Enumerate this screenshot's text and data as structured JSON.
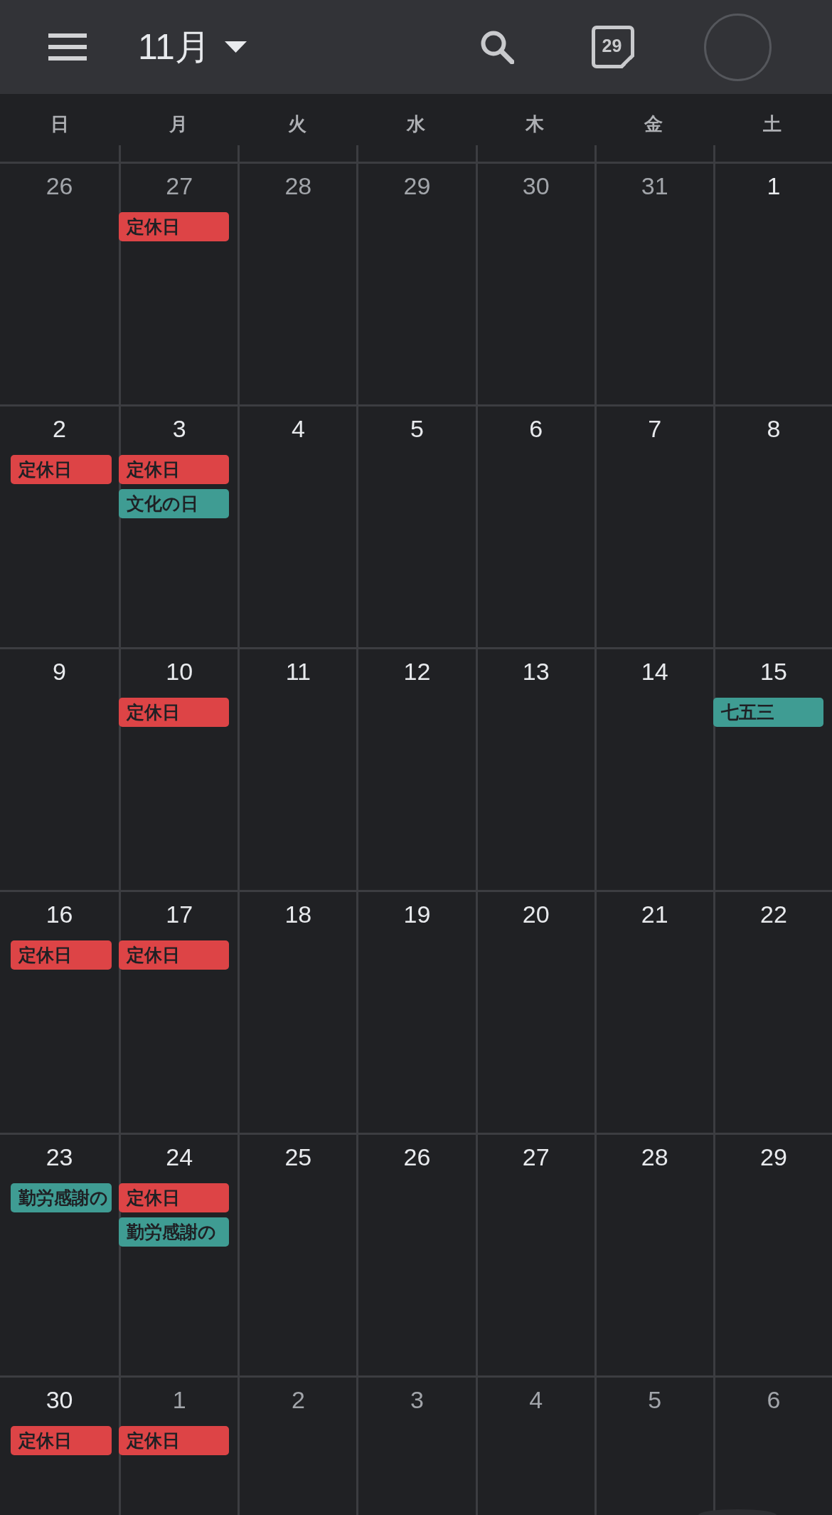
{
  "app_bar": {
    "month_title": "11月",
    "today_button": {
      "label": "29"
    }
  },
  "weekdays": [
    "日",
    "月",
    "火",
    "水",
    "木",
    "金",
    "土"
  ],
  "weeks": [
    {
      "days": [
        {
          "date": "26",
          "in_month": false
        },
        {
          "date": "27",
          "in_month": false,
          "events": [
            {
              "title": "定休日",
              "color": "#dd4446"
            }
          ]
        },
        {
          "date": "28",
          "in_month": false
        },
        {
          "date": "29",
          "in_month": false
        },
        {
          "date": "30",
          "in_month": false
        },
        {
          "date": "31",
          "in_month": false
        },
        {
          "date": "1",
          "in_month": true
        }
      ]
    },
    {
      "days": [
        {
          "date": "2",
          "in_month": true,
          "events": [
            {
              "title": "定休日",
              "color": "#dd4446"
            }
          ]
        },
        {
          "date": "3",
          "in_month": true,
          "events": [
            {
              "title": "定休日",
              "color": "#dd4446"
            },
            {
              "title": "文化の日",
              "color": "#3f9c93"
            }
          ]
        },
        {
          "date": "4",
          "in_month": true
        },
        {
          "date": "5",
          "in_month": true
        },
        {
          "date": "6",
          "in_month": true
        },
        {
          "date": "7",
          "in_month": true
        },
        {
          "date": "8",
          "in_month": true
        }
      ]
    },
    {
      "days": [
        {
          "date": "9",
          "in_month": true
        },
        {
          "date": "10",
          "in_month": true,
          "events": [
            {
              "title": "定休日",
              "color": "#dd4446"
            }
          ]
        },
        {
          "date": "11",
          "in_month": true
        },
        {
          "date": "12",
          "in_month": true
        },
        {
          "date": "13",
          "in_month": true
        },
        {
          "date": "14",
          "in_month": true
        },
        {
          "date": "15",
          "in_month": true,
          "events": [
            {
              "title": "七五三",
              "color": "#3f9c93"
            }
          ]
        }
      ]
    },
    {
      "days": [
        {
          "date": "16",
          "in_month": true,
          "events": [
            {
              "title": "定休日",
              "color": "#dd4446"
            }
          ]
        },
        {
          "date": "17",
          "in_month": true,
          "events": [
            {
              "title": "定休日",
              "color": "#dd4446"
            }
          ]
        },
        {
          "date": "18",
          "in_month": true
        },
        {
          "date": "19",
          "in_month": true
        },
        {
          "date": "20",
          "in_month": true
        },
        {
          "date": "21",
          "in_month": true
        },
        {
          "date": "22",
          "in_month": true
        }
      ]
    },
    {
      "days": [
        {
          "date": "23",
          "in_month": true,
          "events": [
            {
              "title": "勤労感謝の",
              "color": "#3f9c93"
            }
          ]
        },
        {
          "date": "24",
          "in_month": true,
          "events": [
            {
              "title": "定休日",
              "color": "#dd4446"
            },
            {
              "title": "勤労感謝の",
              "color": "#3f9c93"
            }
          ]
        },
        {
          "date": "25",
          "in_month": true
        },
        {
          "date": "26",
          "in_month": true
        },
        {
          "date": "27",
          "in_month": true
        },
        {
          "date": "28",
          "in_month": true
        },
        {
          "date": "29",
          "in_month": true
        }
      ]
    },
    {
      "days": [
        {
          "date": "30",
          "in_month": true,
          "events": [
            {
              "title": "定休日",
              "color": "#dd4446"
            }
          ]
        },
        {
          "date": "1",
          "in_month": false,
          "events": [
            {
              "title": "定休日",
              "color": "#dd4446"
            }
          ]
        },
        {
          "date": "2",
          "in_month": false
        },
        {
          "date": "3",
          "in_month": false
        },
        {
          "date": "4",
          "in_month": false
        },
        {
          "date": "5",
          "in_month": false
        },
        {
          "date": "6",
          "in_month": false
        }
      ]
    }
  ]
}
